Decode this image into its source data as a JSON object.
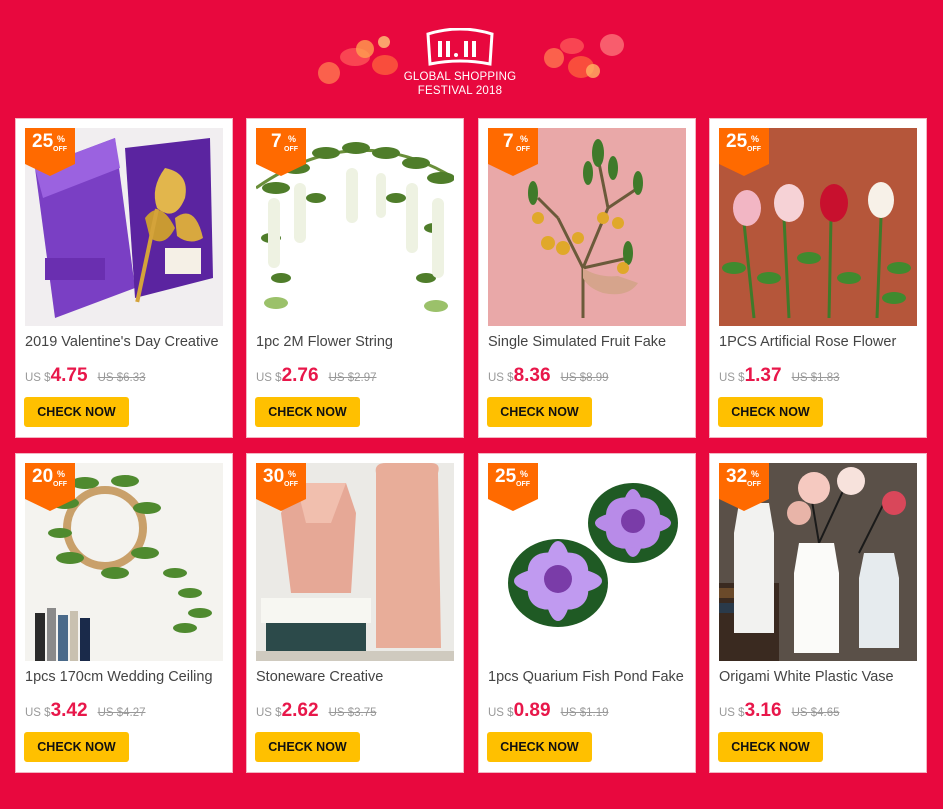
{
  "header": {
    "logo_text": "11.11",
    "line1": "GLOBAL SHOPPING",
    "line2": "FESTIVAL 2018"
  },
  "colors": {
    "background": "#e8083e",
    "price": "#e8174a",
    "button": "#ffc000",
    "badge": "#ff6a00"
  },
  "products": [
    {
      "discount": "25",
      "title": "2019 Valentine's Day Creative",
      "currency": "US $",
      "price": "4.75",
      "old_price": "US $6.33",
      "button": "CHECK NOW",
      "image": "gold-rose-box"
    },
    {
      "discount": "7",
      "title": "1pc 2M Flower String",
      "currency": "US $",
      "price": "2.76",
      "old_price": "US $2.97",
      "button": "CHECK NOW",
      "image": "wisteria-garland"
    },
    {
      "discount": "7",
      "title": "Single Simulated Fruit Fake",
      "currency": "US $",
      "price": "8.36",
      "old_price": "US $8.99",
      "button": "CHECK NOW",
      "image": "fruit-branch"
    },
    {
      "discount": "25",
      "title": "1PCS Artificial Rose Flower",
      "currency": "US $",
      "price": "1.37",
      "old_price": "US $1.83",
      "button": "CHECK NOW",
      "image": "roses"
    },
    {
      "discount": "20",
      "title": "1pcs 170cm Wedding Ceiling",
      "currency": "US $",
      "price": "3.42",
      "old_price": "US $4.27",
      "button": "CHECK NOW",
      "image": "willow-vine"
    },
    {
      "discount": "30",
      "title": "Stoneware Creative",
      "currency": "US $",
      "price": "2.62",
      "old_price": "US $3.75",
      "button": "CHECK NOW",
      "image": "pink-vases"
    },
    {
      "discount": "25",
      "title": "1pcs Quarium Fish Pond Fake",
      "currency": "US $",
      "price": "0.89",
      "old_price": "US $1.19",
      "button": "CHECK NOW",
      "image": "lotus-flowers"
    },
    {
      "discount": "32",
      "title": "Origami White Plastic Vase",
      "currency": "US $",
      "price": "3.16",
      "old_price": "US $4.65",
      "button": "CHECK NOW",
      "image": "white-vases"
    }
  ]
}
